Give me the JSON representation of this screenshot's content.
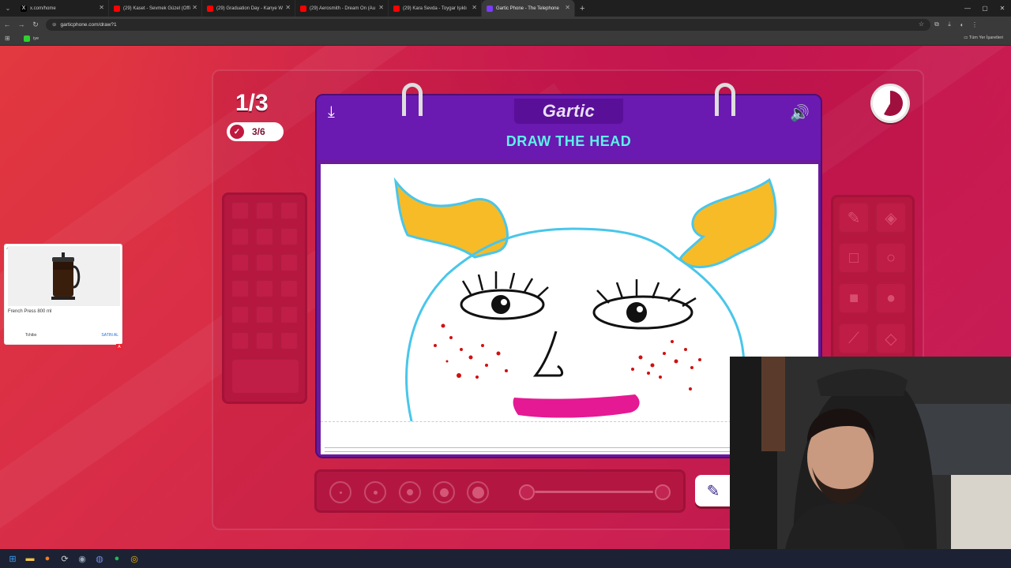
{
  "browser": {
    "tabs": [
      {
        "title": "x.com/home",
        "color": "#111111",
        "icon": "x-logo-icon"
      },
      {
        "title": "(29) Kaset - Sevmek Güzel (Offi",
        "color": "#ff0000",
        "icon": "youtube-icon"
      },
      {
        "title": "(29) Graduation Day - Kanye W",
        "color": "#ff0000",
        "icon": "youtube-icon"
      },
      {
        "title": "(29) Aerosmith - Dream On (Au",
        "color": "#ff0000",
        "icon": "youtube-icon"
      },
      {
        "title": "(29) Kara Sevda - Toygar Işıklı",
        "color": "#ff0000",
        "icon": "youtube-icon"
      },
      {
        "title": "Gartic Phone - The Telephone",
        "color": "#7a3cff",
        "icon": "gartic-icon",
        "active": true
      }
    ],
    "new_tab": "+",
    "url": "garticphone.com/draw?1",
    "bookmark": "iye",
    "all_bookmarks": "Tüm Yer İşaretleri"
  },
  "game": {
    "round": "1/3",
    "players_done": "3/6",
    "logo": "Gartic",
    "prompt": "DRAW THE HEAD",
    "timer_fraction_elapsed": 0.58
  },
  "ad": {
    "tag": "Ad",
    "product": "French Press 800 ml",
    "brand": "Tchibo",
    "cta": "SATIN AL"
  },
  "colors": {
    "accent_cyan": "#5ef0ea",
    "notebook_purple": "#6a1ab0",
    "bg_red": "#d2264c"
  }
}
